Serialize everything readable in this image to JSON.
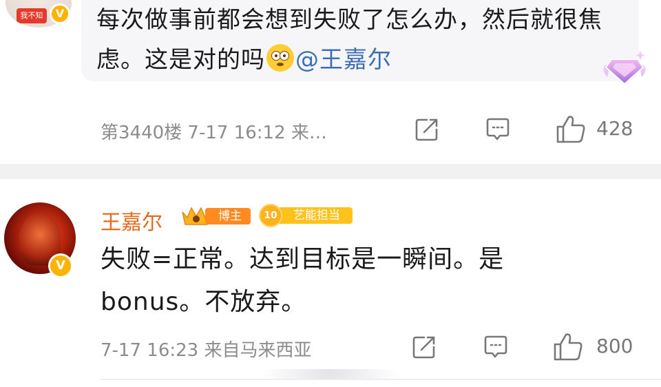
{
  "top_comment": {
    "avatar_tag": "我不知",
    "text_main": "每次做事前都会想到失败了怎么办，然后就很焦虑。这是对的吗",
    "emoji": "flushed-face-emoji",
    "mention": "@王嘉尔",
    "meta": "第3440楼  7-17 16:12  来…",
    "likes": "428"
  },
  "reply": {
    "author": "王嘉尔",
    "badge_blogger": "博主",
    "badge_talent": "艺能担当",
    "badge_talent_level": "10",
    "text": "失败=正常。达到目标是一瞬间。是bonus。不放弃。",
    "meta": "7-17 16:23  来自马来西亚",
    "likes": "800"
  },
  "verified_badge": "V",
  "colors": {
    "name_orange": "#e66a1e",
    "mention_blue": "#3d6fb4",
    "meta_gray": "#8c8c8c",
    "bubble_bg": "#f6f6f8",
    "divider": "#f1f1f1"
  }
}
